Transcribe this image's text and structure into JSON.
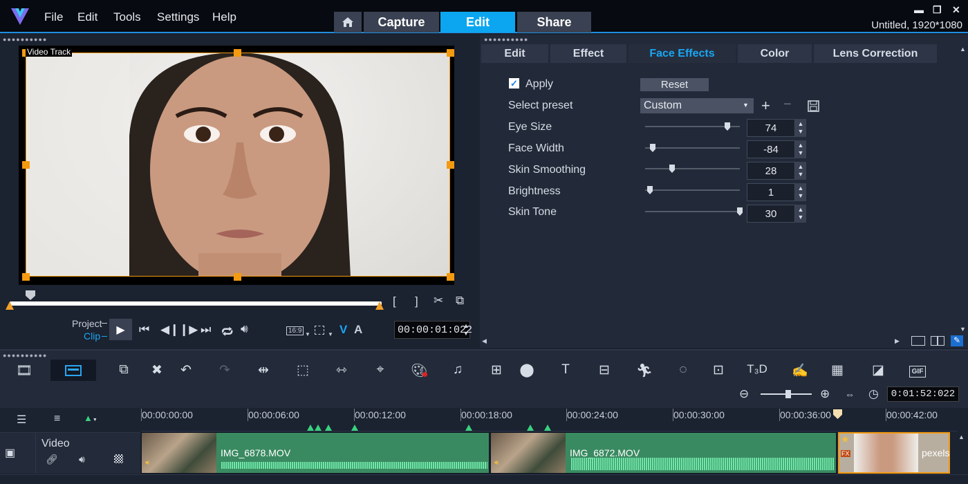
{
  "menu": {
    "file": "File",
    "edit": "Edit",
    "tools": "Tools",
    "settings": "Settings",
    "help": "Help"
  },
  "main_tabs": {
    "capture": "Capture",
    "edit": "Edit",
    "share": "Share"
  },
  "window": {
    "title": "Untitled, 1920*1080"
  },
  "preview": {
    "track_label": "Video Track",
    "project_label": "Project",
    "clip_label": "Clip",
    "aspect": "16:9",
    "timecode": "00:00:01:022"
  },
  "options": {
    "tabs": [
      "Edit",
      "Effect",
      "Face Effects",
      "Color",
      "Lens Correction"
    ],
    "apply_label": "Apply",
    "apply_checked": true,
    "reset_label": "Reset",
    "preset_label": "Select preset",
    "preset_value": "Custom",
    "params": [
      {
        "label": "Eye Size",
        "value": "74"
      },
      {
        "label": "Face Width",
        "value": "-84"
      },
      {
        "label": "Skin Smoothing",
        "value": "28"
      },
      {
        "label": "Brightness",
        "value": "1"
      },
      {
        "label": "Skin Tone",
        "value": "30"
      }
    ]
  },
  "toolbar": {
    "duration": "0:01:52:022"
  },
  "timeline": {
    "ticks": [
      "00:00:00:00",
      "00:00:06:00",
      "00:00:12:00",
      "00:00:18:00",
      "00:00:24:00",
      "00:00:30:00",
      "00:00:36:00",
      "00:00:42:00"
    ],
    "track_name": "Video",
    "clips": [
      {
        "name": "IMG_6878.MOV"
      },
      {
        "name": "IMG_6872.MOV"
      },
      {
        "name": "pexels"
      }
    ]
  },
  "colors": {
    "accent": "#0ca6f0",
    "handle": "#f39a10",
    "clip": "#3a8a61",
    "marker": "#39d17f"
  }
}
